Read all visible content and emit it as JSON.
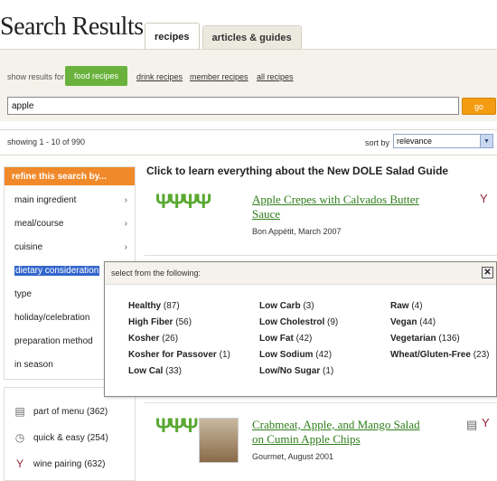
{
  "page": {
    "title": "Search Results"
  },
  "tabs": [
    {
      "label": "recipes",
      "active": true
    },
    {
      "label": "articles & guides",
      "active": false
    }
  ],
  "filter": {
    "show_label": "show results for",
    "options": [
      "food recipes",
      "drink recipes",
      "member recipes",
      "all recipes"
    ],
    "selected": "food recipes"
  },
  "search": {
    "value": "apple",
    "go_label": "go"
  },
  "results_meta": {
    "showing": "showing 1 - 10 of 990",
    "sort_label": "sort by",
    "sort_value": "relevance"
  },
  "refine": {
    "header": "refine this search by...",
    "items": [
      "main ingredient",
      "meal/course",
      "cuisine",
      "dietary consideration",
      "type",
      "holiday/celebration",
      "preparation method",
      "in season"
    ],
    "chevron": "›"
  },
  "extras": [
    {
      "icon": "menu-icon",
      "label": "part of menu (362)"
    },
    {
      "icon": "clock-icon",
      "label": "quick & easy (254)"
    },
    {
      "icon": "wine-glass-icon",
      "label": "wine pairing (632)"
    }
  ],
  "promo": "Click to learn everything about the New DOLE Salad Guide",
  "results": [
    {
      "title_line1": "Apple Crepes with Calvados Butter",
      "title_line2": "Sauce",
      "source": "Bon Appétit, March 2007"
    },
    {
      "title_line1": "Crabmeat, Apple, and Mango Salad",
      "title_line2": "on Cumin Apple Chips",
      "source": "Gourmet, August 2001"
    }
  ],
  "popup": {
    "title": "select from the following:",
    "close": "✕",
    "columns": [
      [
        {
          "name": "Healthy",
          "count": "(87)"
        },
        {
          "name": "High Fiber",
          "count": "(56)"
        },
        {
          "name": "Kosher",
          "count": "(26)"
        },
        {
          "name": "Kosher for Passover",
          "count": "(1)"
        },
        {
          "name": "Low Cal",
          "count": "(33)"
        }
      ],
      [
        {
          "name": "Low Carb",
          "count": "(3)"
        },
        {
          "name": "Low Cholestrol",
          "count": "(9)"
        },
        {
          "name": "Low Fat",
          "count": "(42)"
        },
        {
          "name": "Low Sodium",
          "count": "(42)"
        },
        {
          "name": "Low/No Sugar",
          "count": "(1)"
        }
      ],
      [
        {
          "name": "Raw",
          "count": "(4)"
        },
        {
          "name": "Vegan",
          "count": "(44)"
        },
        {
          "name": "Vegetarian",
          "count": "(136)"
        },
        {
          "name": "Wheat/Gluten-Free",
          "count": "(23)"
        }
      ]
    ]
  },
  "colors": {
    "accent_green": "#6ab23d",
    "accent_orange": "#f0892a",
    "link_green": "#2e7d1a",
    "selection_blue": "#3366cc"
  }
}
